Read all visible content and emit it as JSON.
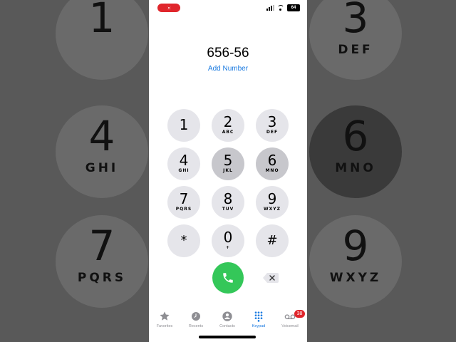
{
  "dialed_number": "656-56",
  "add_number_label": "Add Number",
  "keys": [
    {
      "digit": "1",
      "letters": ""
    },
    {
      "digit": "2",
      "letters": "ABC"
    },
    {
      "digit": "3",
      "letters": "DEF"
    },
    {
      "digit": "4",
      "letters": "GHI"
    },
    {
      "digit": "5",
      "letters": "JKL"
    },
    {
      "digit": "6",
      "letters": "MNO"
    },
    {
      "digit": "7",
      "letters": "PQRS"
    },
    {
      "digit": "8",
      "letters": "TUV"
    },
    {
      "digit": "9",
      "letters": "WXYZ"
    },
    {
      "digit": "*",
      "letters": ""
    },
    {
      "digit": "0",
      "letters": "+"
    },
    {
      "digit": "#",
      "letters": ""
    }
  ],
  "background_keys": [
    {
      "digit": "1",
      "letters": ""
    },
    {
      "digit": "3",
      "letters": "DEF"
    },
    {
      "digit": "4",
      "letters": "GHI"
    },
    {
      "digit": "6",
      "letters": "MNO"
    },
    {
      "digit": "7",
      "letters": "PQRS"
    },
    {
      "digit": "9",
      "letters": "WXYZ"
    }
  ],
  "tabs": [
    {
      "label": "Favorites",
      "icon": "star-icon"
    },
    {
      "label": "Recents",
      "icon": "clock-icon"
    },
    {
      "label": "Contacts",
      "icon": "person-icon"
    },
    {
      "label": "Keypad",
      "icon": "keypad-icon"
    },
    {
      "label": "Voicemail",
      "icon": "voicemail-icon",
      "badge": "38"
    }
  ],
  "status": {
    "battery": "64"
  },
  "colors": {
    "accent": "#1a7ae0",
    "call": "#34c759",
    "badge": "#e0262c",
    "key": "#e5e5ea"
  }
}
